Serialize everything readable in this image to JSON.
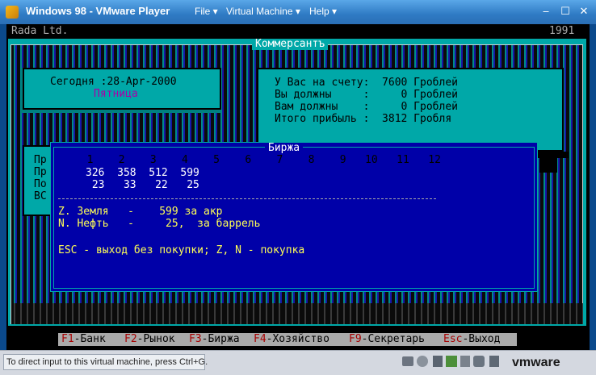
{
  "window": {
    "title": "Windows 98 - VMware Player",
    "menus": [
      "File",
      "Virtual Machine",
      "Help"
    ]
  },
  "dos": {
    "header_left": "Rada Ltd.",
    "header_right": "1991",
    "app_title": "Коммерсантъ",
    "date_line": "Сегодня :28-Apr-2000",
    "weekday": "Пятница",
    "account": {
      "line1": "У Вас на счету:  7600 Гроблей",
      "line2": "Вы должны     :     0 Гроблей",
      "line3": "Вам должны    :     0 Гроблей",
      "line4": "Итого прибыль :  3812 Гробля"
    },
    "left_stub": [
      "Пр",
      "Пр",
      "По",
      "ВС"
    ],
    "exchange": {
      "title": "Биржа",
      "months": "  1    2    3    4    5    6    7    8    9   10   11   12",
      "prices": "326  358  512  599",
      "qty": " 23   33   22   25",
      "item1": "Z. Земля   -    599 за акр",
      "item2": "N. Нефть   -     25,  за баррель",
      "help": "ESC - выход без покупки; Z, N - покупка"
    },
    "fkeys": [
      {
        "key": "F1",
        "label": "-Банк"
      },
      {
        "key": "F2",
        "label": "-Рынок"
      },
      {
        "key": "F3",
        "label": "-Биржа"
      },
      {
        "key": "F4",
        "label": "-Хозяйство"
      },
      {
        "key": "F9",
        "label": "-Секретарь"
      },
      {
        "key": "Esc",
        "label": "-Выход"
      }
    ]
  },
  "statusbar": {
    "hint": "To direct input to this virtual machine, press Ctrl+G.",
    "brand": "vmware"
  },
  "colors": {
    "dos_yellow": "#ffff55",
    "dos_cyan": "#00a8a8",
    "dos_blue": "#0000a8",
    "fkey_red": "#ff5555"
  }
}
